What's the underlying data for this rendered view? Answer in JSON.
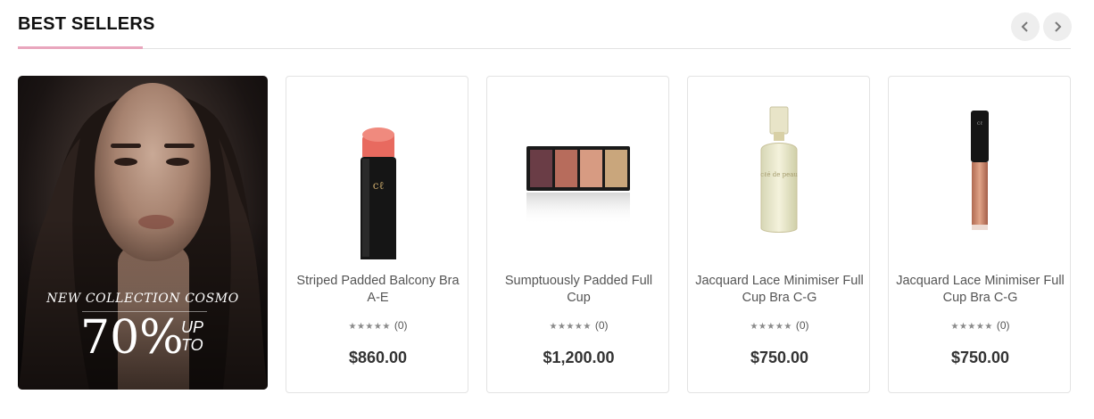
{
  "section": {
    "title": "BEST SELLERS"
  },
  "nav": {
    "prev_icon": "chevron-left-icon",
    "next_icon": "chevron-right-icon"
  },
  "banner": {
    "caption": "NEW COLLECTION COSMO",
    "percent": "70%",
    "up": "UP",
    "to": "TO"
  },
  "products": [
    {
      "name": "Striped Padded Balcony Bra A-E",
      "stars": "★★★★★",
      "reviews": "(0)",
      "price": "$860.00",
      "image": "red-lipstick"
    },
    {
      "name": "Sumptuously Padded Full Cup",
      "stars": "★★★★★",
      "reviews": "(0)",
      "price": "$1,200.00",
      "image": "eyeshadow-palette"
    },
    {
      "name": "Jacquard Lace Minimiser Full Cup Bra C-G",
      "stars": "★★★★★",
      "reviews": "(0)",
      "price": "$750.00",
      "image": "serum-bottle"
    },
    {
      "name": "Jacquard Lace Minimiser Full Cup Bra C-G",
      "stars": "★★★★★",
      "reviews": "(0)",
      "price": "$750.00",
      "image": "lip-gloss-tube"
    }
  ],
  "colors": {
    "accent_underline": "#e9a6bd",
    "border": "#e3e3e3",
    "price": "#333333"
  }
}
